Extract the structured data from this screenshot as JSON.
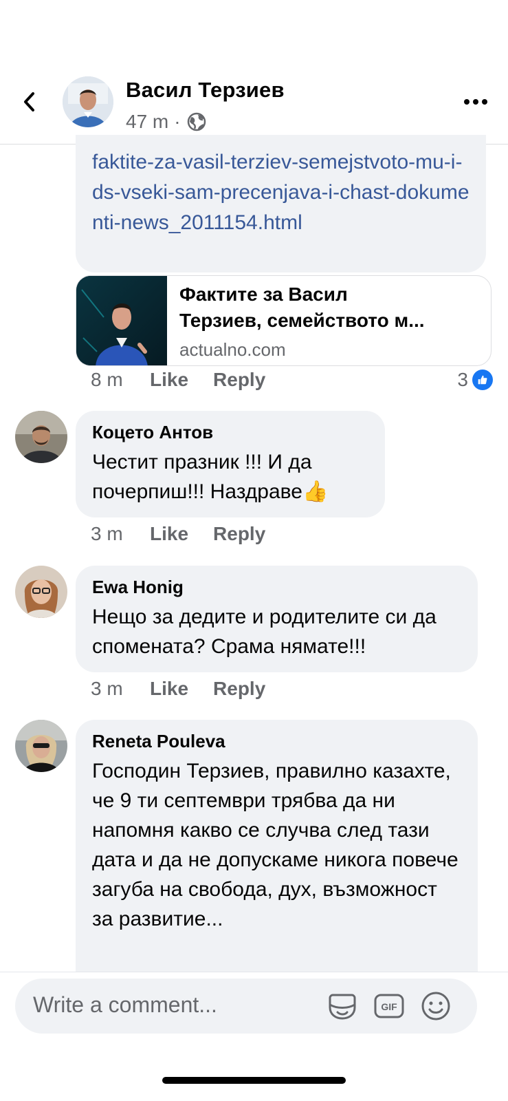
{
  "header": {
    "name": "Васил Терзиев",
    "time": "47 m",
    "separator": "·"
  },
  "link_comment": {
    "url_text": "faktite-za-vasil-terziev-semejstvoto-mu-i-ds-vseki-sam-precenjava-i-chast-dokumenti-news_2011154.html",
    "preview": {
      "title_line1": "Фактите за Васил",
      "title_line2": "Терзиев, семейството м...",
      "domain": "actualno.com"
    },
    "actions": {
      "time": "8 m",
      "like": "Like",
      "reply": "Reply"
    },
    "reaction_count": "3"
  },
  "comments": [
    {
      "author": "Коцето Антов",
      "text": "Честит празник !!! И да почерпиш!!! Наздраве👍",
      "actions": {
        "time": "3 m",
        "like": "Like",
        "reply": "Reply"
      }
    },
    {
      "author": "Ewa Honig",
      "text": "Нещо за дедите и родителите си да спомената? Срама нямате!!!",
      "actions": {
        "time": "3 m",
        "like": "Like",
        "reply": "Reply"
      }
    },
    {
      "author": "Reneta Pouleva",
      "text": "Господин Терзиев, правилно казахте, че 9 ти септември трябва да ни напомня какво се случва след тази дата и да не допускаме никога повече загуба на свобода, дух, възможност за развитие..."
    }
  ],
  "composer": {
    "placeholder": "Write a comment...",
    "icons": [
      "sticker-icon",
      "gif-icon",
      "emoji-icon"
    ],
    "gif_label": "GIF"
  },
  "colors": {
    "link": "#385898",
    "bubble": "#f0f2f5",
    "secondary_text": "#65676b",
    "like_blue": "#1877f2"
  }
}
